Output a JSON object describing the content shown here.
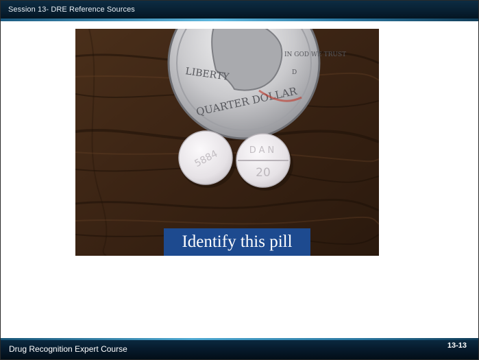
{
  "header": {
    "title": "Session 13- DRE Reference Sources"
  },
  "photo": {
    "caption": "Identify this pill",
    "coin": {
      "legend_left": "LIBERTY",
      "legend_right": "IN GOD WE TRUST",
      "legend_bottom": "QUARTER DOLLAR",
      "mint_mark": "D"
    },
    "pill_left_imprint": "5884",
    "pill_right_imprint_top": "DAN",
    "pill_right_imprint_bottom": "20"
  },
  "footer": {
    "course_title": "Drug Recognition Expert Course",
    "slide_number": "13-13"
  },
  "colors": {
    "header_bg": "#071d2e",
    "header_accent": "#5fb8df",
    "caption_bg": "#1d4a8f",
    "wood": "#3a2515",
    "pill": "#e9e6e9"
  }
}
